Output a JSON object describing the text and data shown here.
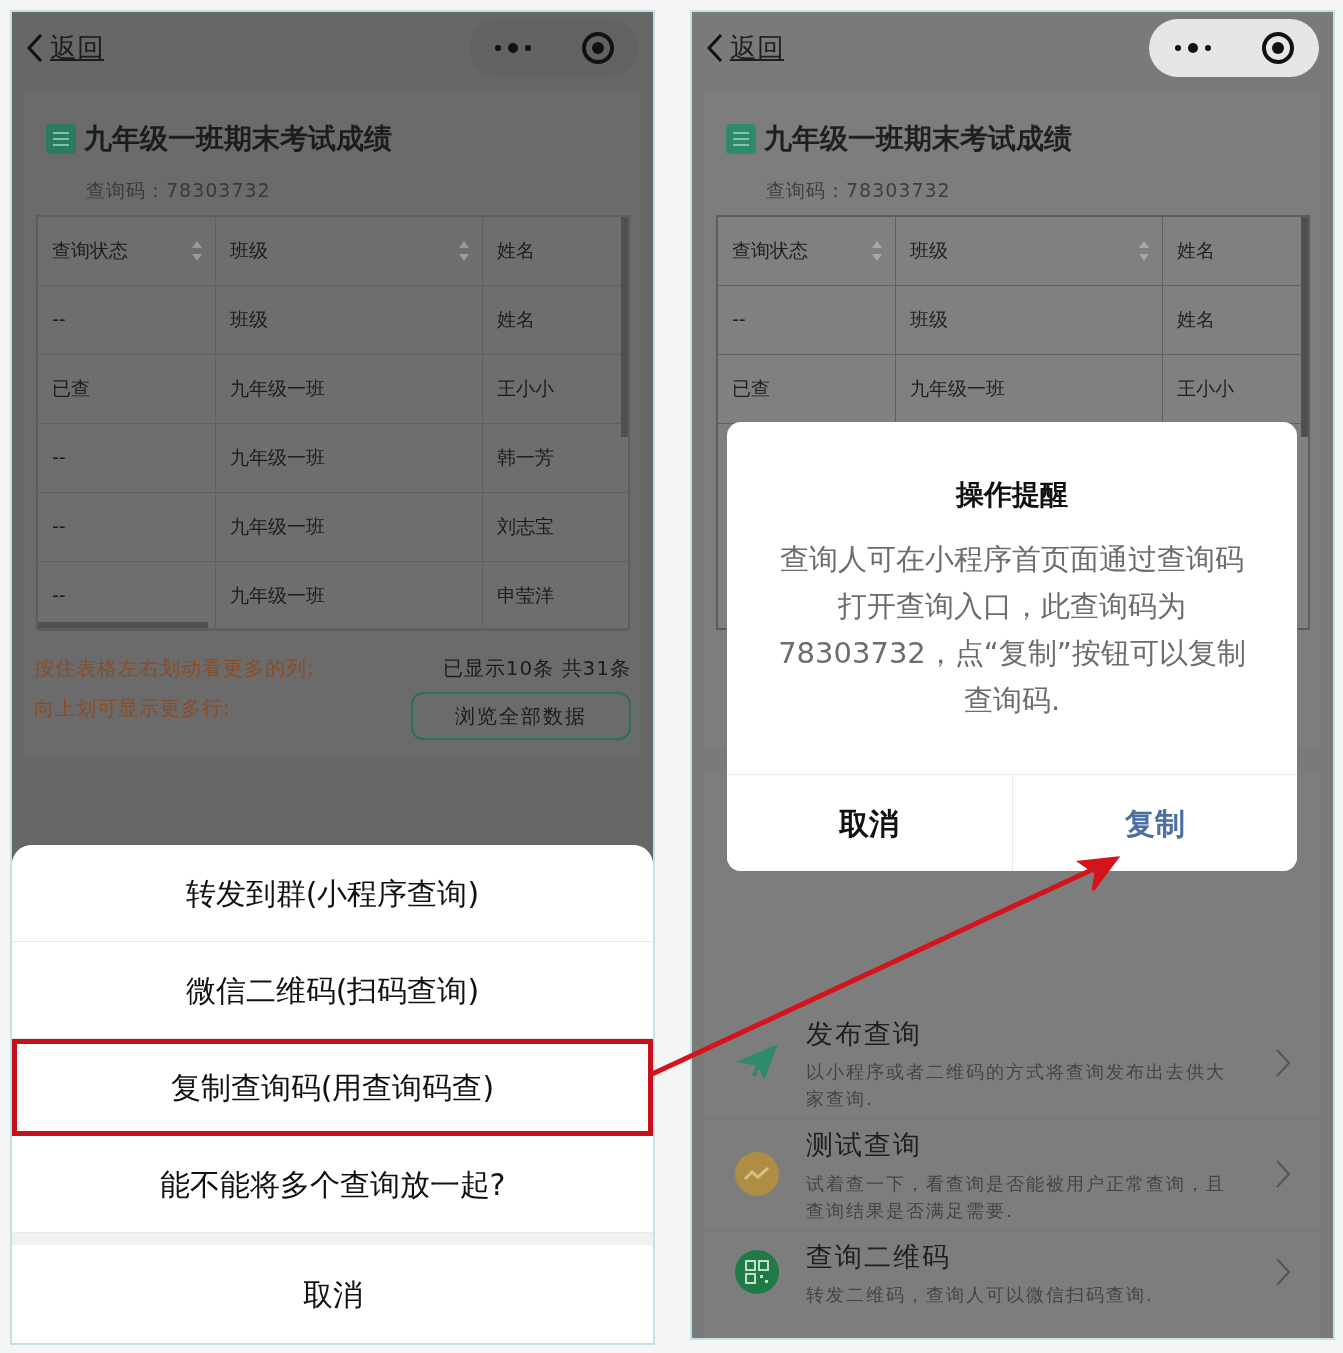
{
  "left_screen": {
    "back": "返回",
    "title": "九年级一班期末考试成绩",
    "query_code": "查询码：78303732",
    "table": {
      "columns": [
        {
          "label": "查询状态",
          "sortable": true
        },
        {
          "label": "班级",
          "sortable": true
        },
        {
          "label": "姓名",
          "sortable": false
        }
      ],
      "rows": [
        [
          "--",
          "班级",
          "姓名"
        ],
        [
          "已查",
          "九年级一班",
          "王小小"
        ],
        [
          "--",
          "九年级一班",
          "韩一芳"
        ],
        [
          "--",
          "九年级一班",
          "刘志宝"
        ],
        [
          "--",
          "九年级一班",
          "申莹洋"
        ]
      ]
    },
    "hints": [
      "按住表格左右划动看更多的列;",
      "向上划可显示更多行;"
    ],
    "count": "已显示10条 共31条",
    "browse_button": "浏览全部数据",
    "action_sheet": {
      "items": [
        {
          "label": "转发到群(小程序查询)",
          "highlighted": false
        },
        {
          "label": "微信二维码(扫码查询)",
          "highlighted": false
        },
        {
          "label": "复制查询码(用查询码查)",
          "highlighted": true
        },
        {
          "label": "能不能将多个查询放一起?",
          "highlighted": false
        }
      ],
      "cancel": "取消"
    }
  },
  "right_screen": {
    "back": "返回",
    "title": "九年级一班期末考试成绩",
    "query_code": "查询码：78303732",
    "table": {
      "columns": [
        {
          "label": "查询状态",
          "sortable": true
        },
        {
          "label": "班级",
          "sortable": true
        },
        {
          "label": "姓名",
          "sortable": false
        }
      ],
      "rows": [
        [
          "--",
          "班级",
          "姓名"
        ],
        [
          "已查",
          "九年级一班",
          "王小小"
        ]
      ]
    },
    "actions": [
      {
        "kind": "send",
        "title": "发布查询",
        "description": "以小程序或者二维码的方式将查询发布出去供大家查询."
      },
      {
        "kind": "test",
        "title": "测试查询",
        "description": "试着查一下，看查询是否能被用户正常查询，且查询结果是否满足需要."
      },
      {
        "kind": "qr",
        "title": "查询二维码",
        "description": "转发二维码，查询人可以微信扫码查询."
      }
    ],
    "dialog": {
      "title": "操作提醒",
      "message": "查询人可在小程序首页面通过查询码打开查询入口，此查询码为78303732，点“复制”按钮可以复制查询码.",
      "buttons": [
        {
          "label": "取消",
          "primary": false
        },
        {
          "label": "复制",
          "primary": true
        }
      ]
    }
  }
}
